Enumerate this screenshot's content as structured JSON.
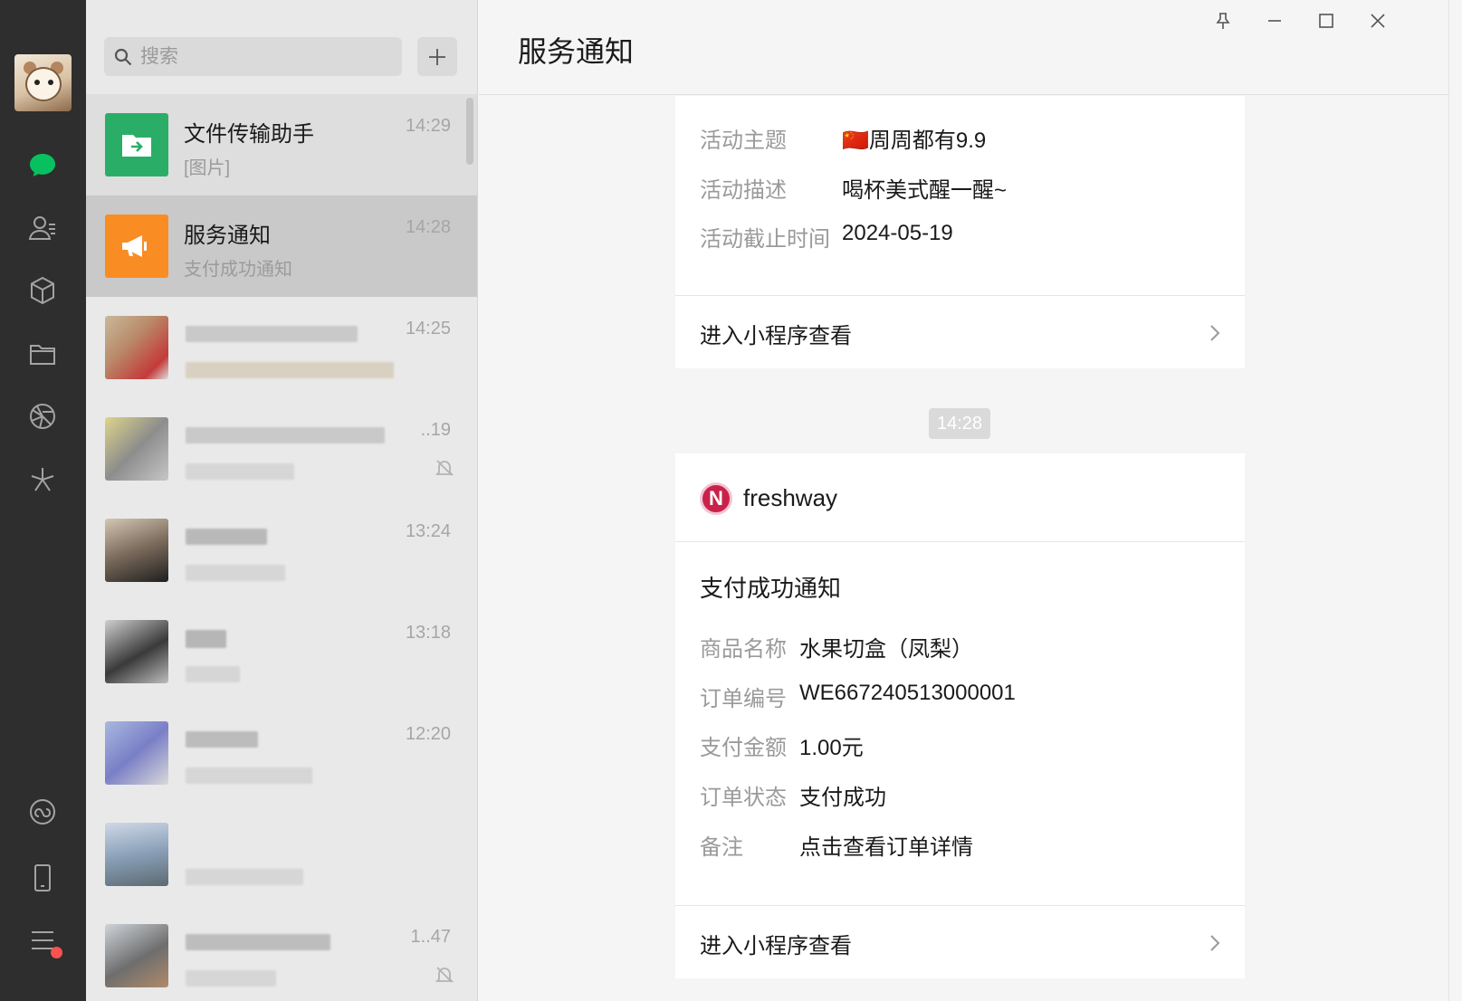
{
  "window": {
    "title": "服务通知"
  },
  "search": {
    "placeholder": "搜索"
  },
  "chats": [
    {
      "name": "文件传输助手",
      "preview": "[图片]",
      "time": "14:29",
      "thumb_color": "#2aae67"
    },
    {
      "name": "服务通知",
      "preview": "支付成功通知",
      "time": "14:28",
      "thumb_color": "#fa8c24"
    },
    {
      "name": "",
      "preview": "",
      "time": "14:25"
    },
    {
      "name": "",
      "preview": "",
      "time": "..19"
    },
    {
      "name": "",
      "preview": "",
      "time": "13:24"
    },
    {
      "name": "",
      "preview": "",
      "time": "13:18"
    },
    {
      "name": "",
      "preview": "",
      "time": "12:20"
    },
    {
      "name": "",
      "preview": "",
      "time": ""
    },
    {
      "name": "",
      "preview": "",
      "time": "1..47"
    }
  ],
  "card1": {
    "fields": [
      {
        "key": "活动主题",
        "value": "🇨🇳周周都有9.9"
      },
      {
        "key": "活动描述",
        "value": "喝杯美式醒一醒~"
      },
      {
        "key": "活动截止时间",
        "value": "2024-05-19"
      }
    ],
    "link_label": "进入小程序查看"
  },
  "timestamp": "14:28",
  "card2": {
    "brand": "freshway",
    "brand_initial": "N",
    "title": "支付成功通知",
    "fields": [
      {
        "key": "商品名称",
        "value": "水果切盒（凤梨）"
      },
      {
        "key": "订单编号",
        "value": "WE667240513000001"
      },
      {
        "key": "支付金额",
        "value": "1.00元"
      },
      {
        "key": "订单状态",
        "value": "支付成功"
      },
      {
        "key": "备注",
        "value": "点击查看订单详情"
      }
    ],
    "link_label": "进入小程序查看"
  },
  "colors": {
    "accent_green": "#07c160",
    "notify_orange": "#fa8c24",
    "file_green": "#2aae67",
    "brand_red": "#c9224a"
  }
}
